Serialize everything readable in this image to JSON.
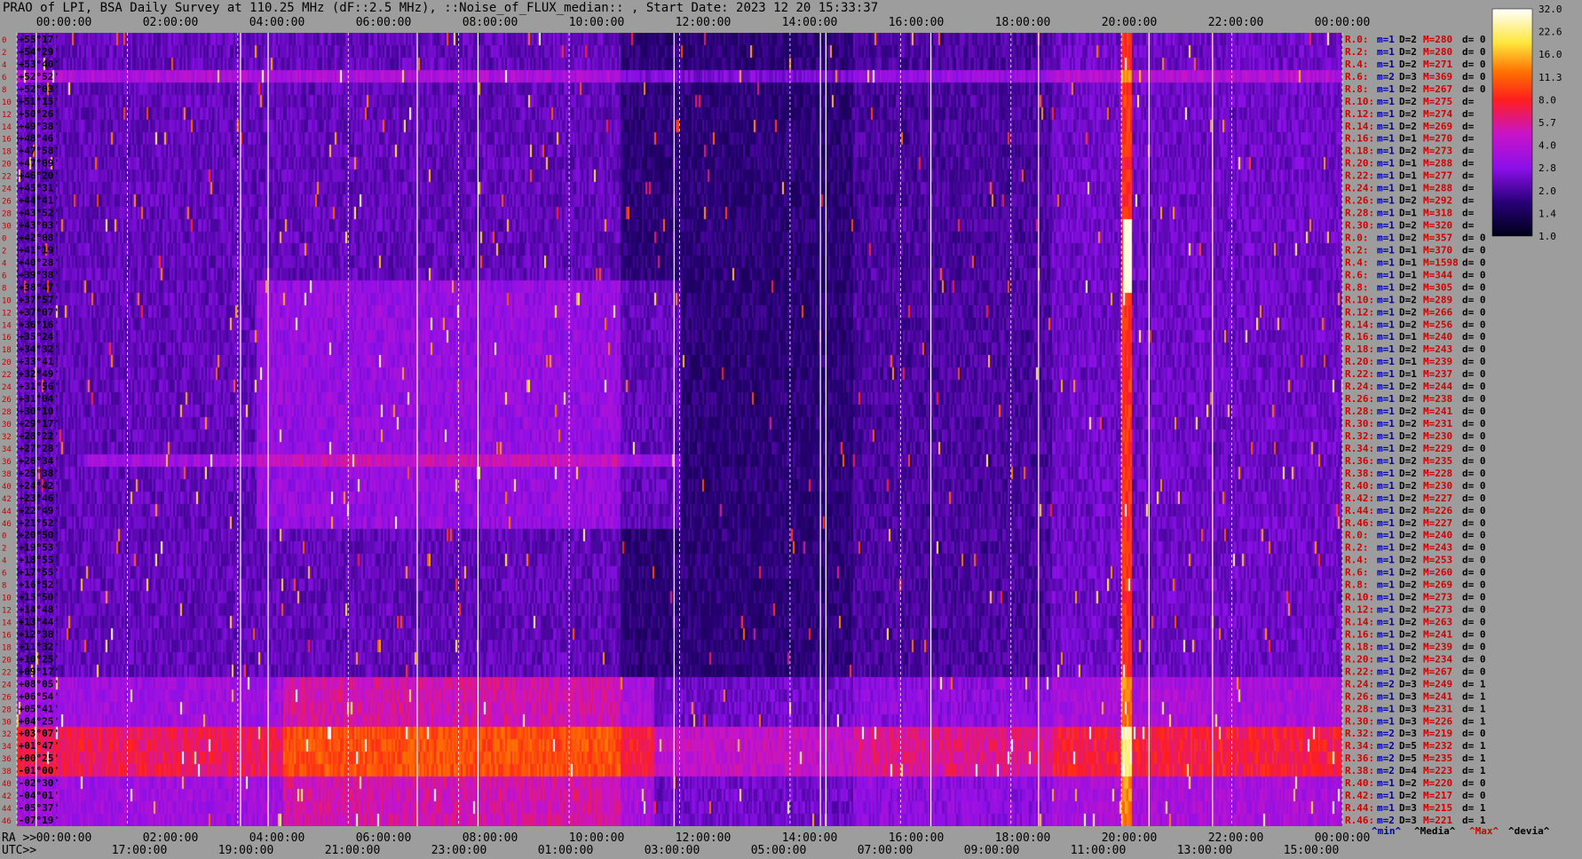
{
  "title": "PRAO of LPI, BSA Daily Survey at 110.25 MHz (dF::2.5 MHz), ::Noise_of_FLUX_median:: , Start Date: 2023 12 20 15:33:37",
  "chart_data": {
    "type": "heatmap",
    "x_top_ticks": [
      "00:00:00",
      "02:00:00",
      "04:00:00",
      "06:00:00",
      "08:00:00",
      "10:00:00",
      "12:00:00",
      "14:00:00",
      "16:00:00",
      "18:00:00",
      "20:00:00",
      "22:00:00",
      "00:00:00"
    ],
    "x_bottom_label": "RA >>",
    "x_bottom_ticks": [
      "00:00:00",
      "02:00:00",
      "04:00:00",
      "06:00:00",
      "08:00:00",
      "10:00:00",
      "12:00:00",
      "14:00:00",
      "16:00:00",
      "18:00:00",
      "20:00:00",
      "22:00:00",
      "00:00:00"
    ],
    "utc_label": "UTC>>",
    "utc_ticks": [
      "17:00:00",
      "19:00:00",
      "21:00:00",
      "23:00:00",
      "01:00:00",
      "03:00:00",
      "05:00:00",
      "07:00:00",
      "09:00:00",
      "11:00:00",
      "13:00:00",
      "15:00:00"
    ],
    "declinations": [
      "+55°17'",
      "+54°29'",
      "+53°40'",
      "+52°52'",
      "+52°03'",
      "+51°15'",
      "+50°26'",
      "+49°38'",
      "+48°46'",
      "+47°58'",
      "+47°09'",
      "+46°20'",
      "+45°31'",
      "+44°41'",
      "+43°52'",
      "+43°03'",
      "+42°08'",
      "+41°19'",
      "+40°28'",
      "+39°38'",
      "+38°47'",
      "+37°57'",
      "+37°07'",
      "+36°16'",
      "+35°24'",
      "+34°32'",
      "+33°41'",
      "+32°49'",
      "+31°56'",
      "+31°04'",
      "+30°10'",
      "+29°17'",
      "+28°22'",
      "+27°28'",
      "+26°34'",
      "+25°38'",
      "+24°42'",
      "+23°46'",
      "+22°49'",
      "+21°52'",
      "+20°50'",
      "+19°53'",
      "+18°55'",
      "+17°55'",
      "+16°52'",
      "+15°50'",
      "+14°48'",
      "+13°44'",
      "+12°38'",
      "+11°32'",
      "+10°25'",
      "+09°17'",
      "+08°05'",
      "+06°54'",
      "+05°41'",
      "+04°25'",
      "+03°07'",
      "+01°47'",
      "+00°25'",
      "-01°00'",
      "-02°30'",
      "-04°01'",
      "-05°37'",
      "-07°19'"
    ],
    "row_index": [
      "0",
      "2",
      "4",
      "6",
      "8",
      "10",
      "12",
      "14",
      "16",
      "18",
      "20",
      "22",
      "24",
      "26",
      "28",
      "30",
      "0",
      "2",
      "4",
      "6",
      "8",
      "10",
      "12",
      "14",
      "16",
      "18",
      "20",
      "22",
      "24",
      "26",
      "28",
      "30",
      "32",
      "34",
      "36",
      "38",
      "40",
      "42",
      "44",
      "46",
      "0",
      "2",
      "4",
      "6",
      "8",
      "10",
      "12",
      "14",
      "16",
      "18",
      "20",
      "22",
      "24",
      "26",
      "28",
      "30",
      "32",
      "34",
      "36",
      "38",
      "40",
      "42",
      "44",
      "46"
    ],
    "stats": [
      {
        "r": "R.0:",
        "m": "m=1",
        "D": "D=2",
        "M": "M=280",
        "d": "d= 0"
      },
      {
        "r": "R.2:",
        "m": "m=1",
        "D": "D=2",
        "M": "M=280",
        "d": "d= 0"
      },
      {
        "r": "R.4:",
        "m": "m=1",
        "D": "D=2",
        "M": "M=271",
        "d": "d= 0"
      },
      {
        "r": "R.6:",
        "m": "m=2",
        "D": "D=3",
        "M": "M=369",
        "d": "d= 0"
      },
      {
        "r": "R.8:",
        "m": "m=1",
        "D": "D=2",
        "M": "M=267",
        "d": "d= 0"
      },
      {
        "r": "R.10:",
        "m": "m=1",
        "D": "D=2",
        "M": "M=275",
        "d": "d="
      },
      {
        "r": "R.12:",
        "m": "m=1",
        "D": "D=2",
        "M": "M=274",
        "d": "d="
      },
      {
        "r": "R.14:",
        "m": "m=1",
        "D": "D=2",
        "M": "M=269",
        "d": "d="
      },
      {
        "r": "R.16:",
        "m": "m=1",
        "D": "D=1",
        "M": "M=270",
        "d": "d="
      },
      {
        "r": "R.18:",
        "m": "m=1",
        "D": "D=2",
        "M": "M=273",
        "d": "d="
      },
      {
        "r": "R.20:",
        "m": "m=1",
        "D": "D=1",
        "M": "M=288",
        "d": "d="
      },
      {
        "r": "R.22:",
        "m": "m=1",
        "D": "D=1",
        "M": "M=277",
        "d": "d="
      },
      {
        "r": "R.24:",
        "m": "m=1",
        "D": "D=1",
        "M": "M=288",
        "d": "d="
      },
      {
        "r": "R.26:",
        "m": "m=1",
        "D": "D=2",
        "M": "M=292",
        "d": "d="
      },
      {
        "r": "R.28:",
        "m": "m=1",
        "D": "D=1",
        "M": "M=318",
        "d": "d="
      },
      {
        "r": "R.30:",
        "m": "m=1",
        "D": "D=2",
        "M": "M=320",
        "d": "d="
      },
      {
        "r": "R.0:",
        "m": "m=1",
        "D": "D=2",
        "M": "M=357",
        "d": "d= 0"
      },
      {
        "r": "R.2:",
        "m": "m=1",
        "D": "D=1",
        "M": "M=370",
        "d": "d= 0"
      },
      {
        "r": "R.4:",
        "m": "m=1",
        "D": "D=1",
        "M": "M=1598",
        "d": "d= 0"
      },
      {
        "r": "R.6:",
        "m": "m=1",
        "D": "D=1",
        "M": "M=344",
        "d": "d= 0"
      },
      {
        "r": "R.8:",
        "m": "m=1",
        "D": "D=2",
        "M": "M=305",
        "d": "d= 0"
      },
      {
        "r": "R.10:",
        "m": "m=1",
        "D": "D=2",
        "M": "M=289",
        "d": "d= 0"
      },
      {
        "r": "R.12:",
        "m": "m=1",
        "D": "D=2",
        "M": "M=266",
        "d": "d= 0"
      },
      {
        "r": "R.14:",
        "m": "m=1",
        "D": "D=2",
        "M": "M=256",
        "d": "d= 0"
      },
      {
        "r": "R.16:",
        "m": "m=1",
        "D": "D=1",
        "M": "M=240",
        "d": "d= 0"
      },
      {
        "r": "R.18:",
        "m": "m=1",
        "D": "D=2",
        "M": "M=243",
        "d": "d= 0"
      },
      {
        "r": "R.20:",
        "m": "m=1",
        "D": "D=1",
        "M": "M=239",
        "d": "d= 0"
      },
      {
        "r": "R.22:",
        "m": "m=1",
        "D": "D=1",
        "M": "M=237",
        "d": "d= 0"
      },
      {
        "r": "R.24:",
        "m": "m=1",
        "D": "D=2",
        "M": "M=244",
        "d": "d= 0"
      },
      {
        "r": "R.26:",
        "m": "m=1",
        "D": "D=2",
        "M": "M=238",
        "d": "d= 0"
      },
      {
        "r": "R.28:",
        "m": "m=1",
        "D": "D=2",
        "M": "M=241",
        "d": "d= 0"
      },
      {
        "r": "R.30:",
        "m": "m=1",
        "D": "D=2",
        "M": "M=231",
        "d": "d= 0"
      },
      {
        "r": "R.32:",
        "m": "m=1",
        "D": "D=2",
        "M": "M=230",
        "d": "d= 0"
      },
      {
        "r": "R.34:",
        "m": "m=1",
        "D": "D=2",
        "M": "M=229",
        "d": "d= 0"
      },
      {
        "r": "R.36:",
        "m": "m=1",
        "D": "D=2",
        "M": "M=235",
        "d": "d= 0"
      },
      {
        "r": "R.38:",
        "m": "m=1",
        "D": "D=2",
        "M": "M=228",
        "d": "d= 0"
      },
      {
        "r": "R.40:",
        "m": "m=1",
        "D": "D=2",
        "M": "M=230",
        "d": "d= 0"
      },
      {
        "r": "R.42:",
        "m": "m=1",
        "D": "D=2",
        "M": "M=227",
        "d": "d= 0"
      },
      {
        "r": "R.44:",
        "m": "m=1",
        "D": "D=2",
        "M": "M=226",
        "d": "d= 0"
      },
      {
        "r": "R.46:",
        "m": "m=1",
        "D": "D=2",
        "M": "M=227",
        "d": "d= 0"
      },
      {
        "r": "R.0:",
        "m": "m=1",
        "D": "D=2",
        "M": "M=240",
        "d": "d= 0"
      },
      {
        "r": "R.2:",
        "m": "m=1",
        "D": "D=2",
        "M": "M=243",
        "d": "d= 0"
      },
      {
        "r": "R.4:",
        "m": "m=1",
        "D": "D=2",
        "M": "M=253",
        "d": "d= 0"
      },
      {
        "r": "R.6:",
        "m": "m=1",
        "D": "D=2",
        "M": "M=260",
        "d": "d= 0"
      },
      {
        "r": "R.8:",
        "m": "m=1",
        "D": "D=2",
        "M": "M=269",
        "d": "d= 0"
      },
      {
        "r": "R.10:",
        "m": "m=1",
        "D": "D=2",
        "M": "M=273",
        "d": "d= 0"
      },
      {
        "r": "R.12:",
        "m": "m=1",
        "D": "D=2",
        "M": "M=273",
        "d": "d= 0"
      },
      {
        "r": "R.14:",
        "m": "m=1",
        "D": "D=2",
        "M": "M=263",
        "d": "d= 0"
      },
      {
        "r": "R.16:",
        "m": "m=1",
        "D": "D=2",
        "M": "M=241",
        "d": "d= 0"
      },
      {
        "r": "R.18:",
        "m": "m=1",
        "D": "D=2",
        "M": "M=239",
        "d": "d= 0"
      },
      {
        "r": "R.20:",
        "m": "m=1",
        "D": "D=2",
        "M": "M=234",
        "d": "d= 0"
      },
      {
        "r": "R.22:",
        "m": "m=1",
        "D": "D=2",
        "M": "M=267",
        "d": "d= 0"
      },
      {
        "r": "R.24:",
        "m": "m=2",
        "D": "D=3",
        "M": "M=249",
        "d": "d= 1"
      },
      {
        "r": "R.26:",
        "m": "m=1",
        "D": "D=3",
        "M": "M=241",
        "d": "d= 1"
      },
      {
        "r": "R.28:",
        "m": "m=1",
        "D": "D=3",
        "M": "M=231",
        "d": "d= 1"
      },
      {
        "r": "R.30:",
        "m": "m=1",
        "D": "D=3",
        "M": "M=226",
        "d": "d= 1"
      },
      {
        "r": "R.32:",
        "m": "m=2",
        "D": "D=3",
        "M": "M=219",
        "d": "d= 0"
      },
      {
        "r": "R.34:",
        "m": "m=2",
        "D": "D=5",
        "M": "M=232",
        "d": "d= 1"
      },
      {
        "r": "R.36:",
        "m": "m=2",
        "D": "D=5",
        "M": "M=235",
        "d": "d= 1"
      },
      {
        "r": "R.38:",
        "m": "m=2",
        "D": "D=4",
        "M": "M=223",
        "d": "d= 1"
      },
      {
        "r": "R.40:",
        "m": "m=1",
        "D": "D=2",
        "M": "M=220",
        "d": "d= 0"
      },
      {
        "r": "R.42:",
        "m": "m=1",
        "D": "D=2",
        "M": "M=217",
        "d": "d= 0"
      },
      {
        "r": "R.44:",
        "m": "m=1",
        "D": "D=3",
        "M": "M=215",
        "d": "d= 1"
      },
      {
        "r": "R.46:",
        "m": "m=2",
        "D": "D=3",
        "M": "M=221",
        "d": "d= 1"
      }
    ],
    "colorbar": {
      "ticks": [
        "32.0",
        "22.6",
        "16.0",
        "11.3",
        "8.0",
        "5.7",
        "4.0",
        "2.8",
        "2.0",
        "1.4",
        "1.0"
      ],
      "scale": "log"
    },
    "legend": [
      {
        "label": "^min^",
        "color": "#0000a0"
      },
      {
        "label": "^Media^",
        "color": "#000000"
      },
      {
        "label": "^Max^",
        "color": "#d00000"
      },
      {
        "label": "^devia^",
        "color": "#000000"
      }
    ],
    "solid_lines_ra": [
      "00:30",
      "04:40",
      "20:30",
      "21:35",
      "04:10",
      "06:20",
      "08:20",
      "12:00",
      "14:50",
      "14:55",
      "16:40",
      "19:00"
    ],
    "colors": {
      "background": "#9d9d9d",
      "low": "#000018",
      "mid": "#8c10e8",
      "high": "#ff2000",
      "peak": "#ffffff"
    }
  }
}
